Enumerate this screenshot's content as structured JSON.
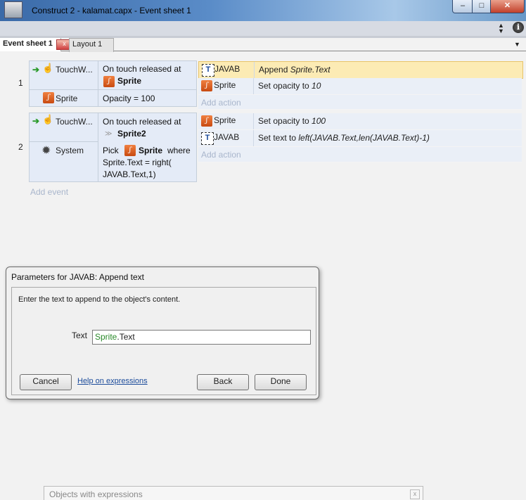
{
  "window": {
    "title": "Construct 2 - kalamat.capx - Event sheet 1",
    "min": "‒",
    "max": "□",
    "close": "✕"
  },
  "tabs": {
    "event_sheet": "Event sheet 1",
    "layout": "Layout 1",
    "close": "x"
  },
  "events": [
    {
      "number": "1",
      "conditions": [
        {
          "object": "TouchW...",
          "text": "On touch released at",
          "target": "Sprite"
        },
        {
          "object": "Sprite",
          "text": "Opacity = 100"
        }
      ],
      "actions": [
        {
          "object": "JAVAB",
          "plain": "Append ",
          "italic": "Sprite.Text"
        },
        {
          "object": "Sprite",
          "plain": "Set opacity to ",
          "italic": "10"
        }
      ],
      "add_action": "Add action"
    },
    {
      "number": "2",
      "conditions": [
        {
          "object": "TouchW...",
          "text": "On touch released at",
          "target": "Sprite2"
        },
        {
          "object": "System",
          "pick_prefix": "Pick",
          "pick_object": "Sprite",
          "pick_where": "where",
          "line2": "Sprite.Text = right(",
          "line3": "JAVAB.Text,1)"
        }
      ],
      "actions": [
        {
          "object": "Sprite",
          "plain": "Set opacity to ",
          "italic": "100"
        },
        {
          "object": "JAVAB",
          "plain": "Set text to ",
          "italic": "left(JAVAB.Text,len(JAVAB.Text)-1)"
        }
      ],
      "add_action": "Add action"
    }
  ],
  "add_event": "Add event",
  "dialog": {
    "title": "Parameters for JAVAB: Append text",
    "description": "Enter the text to append to the object's content.",
    "field_label": "Text",
    "field_value_obj": "Sprite",
    "field_value_rest": ".Text",
    "cancel": "Cancel",
    "help": "Help on expressions",
    "back": "Back",
    "done": "Done"
  },
  "objects_panel": {
    "title": "Objects with expressions",
    "close": "x"
  },
  "colors": {
    "accent": "#3a6aa8",
    "selected_action": "#fcebb4",
    "expression_object": "#2a8a2a"
  }
}
